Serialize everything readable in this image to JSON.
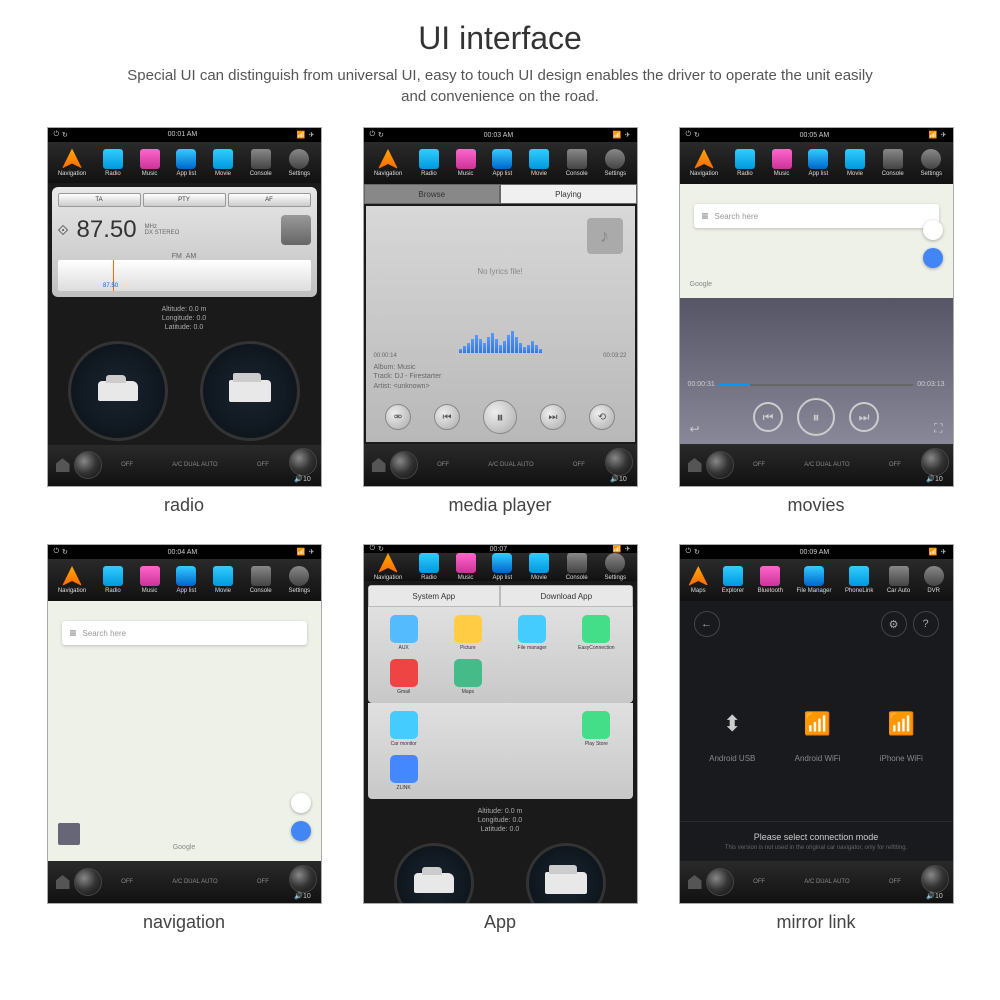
{
  "header": {
    "title": "UI interface",
    "subtitle": "Special UI can distinguish from universal UI, easy to touch UI design enables the driver to operate the unit easily and convenience on the road."
  },
  "nav_standard": [
    "Navigation",
    "Radio",
    "Music",
    "App list",
    "Movie",
    "Console",
    "Settings"
  ],
  "nav_mirror": [
    "Maps",
    "Explorer",
    "Bluetooth",
    "File Manager",
    "PhoneLink",
    "Car Auto",
    "DVR"
  ],
  "captions": {
    "radio": "radio",
    "media": "media player",
    "movies": "movies",
    "navigation": "navigation",
    "app": "App",
    "mirror": "mirror link"
  },
  "status": {
    "radio": "00:01 AM",
    "media": "00:03 AM",
    "movies": "00:05 AM",
    "navigation": "00:04 AM",
    "app": "00:07",
    "mirror": "00:09 AM"
  },
  "radio": {
    "buttons": [
      "TA",
      "PTY",
      "AF"
    ],
    "freq": "87.50",
    "unit": "MHz",
    "info": "DX STEREO",
    "band": "FM",
    "band2": "AM",
    "dial_label": "87.50"
  },
  "gps": {
    "alt": "Altitude:  0.0 m",
    "lon": "Longitude:  0.0",
    "lat": "Latitude:  0.0"
  },
  "climate": {
    "label": "A/C  DUAL  AUTO",
    "vol": "10",
    "off": "OFF"
  },
  "media": {
    "tabs": [
      "Browse",
      "Playing"
    ],
    "no_lyrics": "No lyrics file!",
    "t1": "00:00:14",
    "t2": "00:03:22",
    "album_l": "Album:",
    "album": "Music",
    "track_l": "Track:",
    "track": "DJ - Firestarter",
    "artist_l": "Artist:",
    "artist": "<unknown>"
  },
  "movies": {
    "t1": "00:00:31",
    "t2": "00:03:13",
    "search": "Search here",
    "google": "Google"
  },
  "nav_screen": {
    "search": "Search here",
    "google": "Google"
  },
  "app": {
    "tabs": [
      "System App",
      "Download App"
    ],
    "r1": [
      "AUX",
      "Picture",
      "File manager",
      "EasyConnection",
      "Gmail",
      "Maps"
    ],
    "r2": [
      "Car monitor",
      "",
      "",
      "Play Store",
      "ZLINK",
      ""
    ]
  },
  "mirror": {
    "opts": [
      {
        "lbl": "Android USB",
        "c": "#cccccc"
      },
      {
        "lbl": "Android WiFi",
        "c": "#ffcc00"
      },
      {
        "lbl": "iPhone WiFi",
        "c": "#66dd66"
      }
    ],
    "title": "Please select connection mode",
    "sub": "This version is not used in the original car navigator, only for refitting."
  }
}
